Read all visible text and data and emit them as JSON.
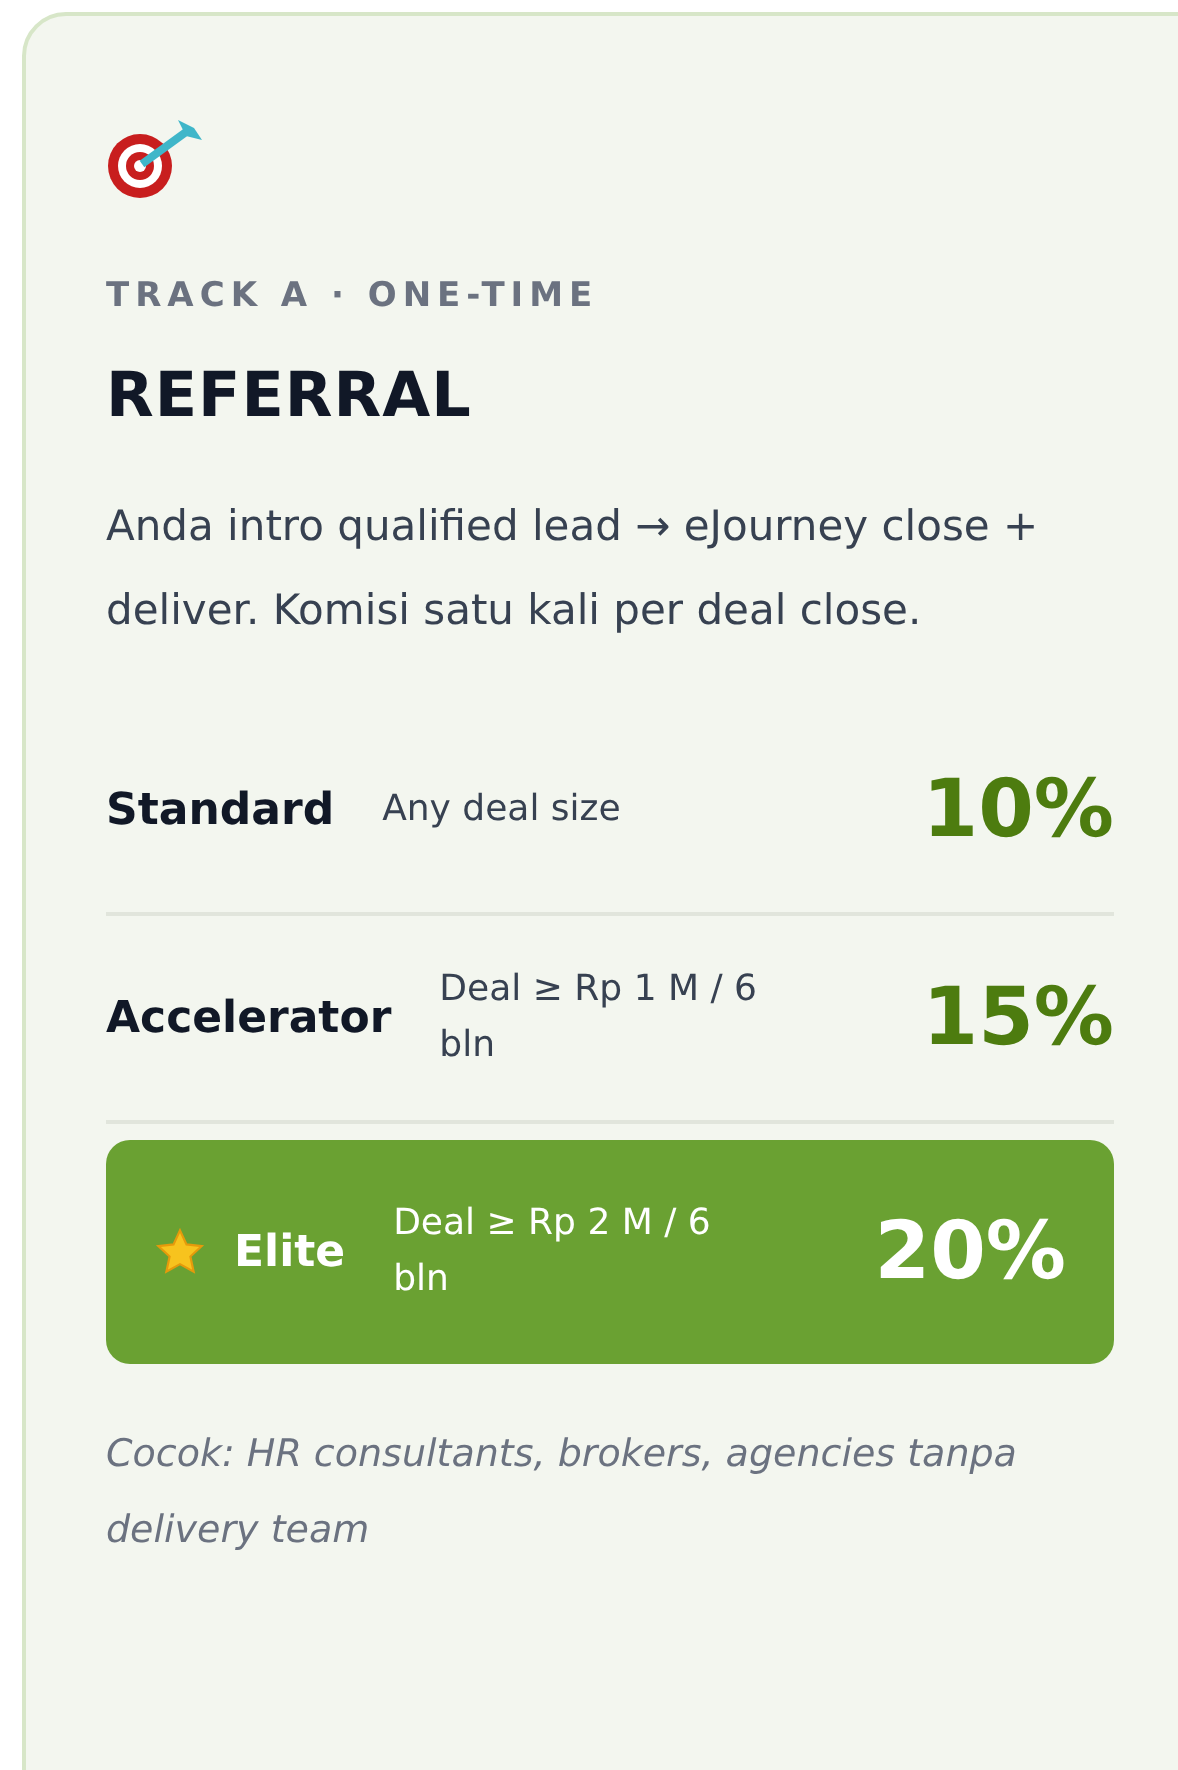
{
  "card": {
    "eyebrow": "TRACK A · ONE-TIME",
    "title": "REFERRAL",
    "description": "Anda intro qualified lead → eJourney close + deliver. Komisi satu kali per deal close.",
    "tiers": [
      {
        "name": "Standard",
        "condition": "Any deal size",
        "rate": "10%",
        "highlighted": false
      },
      {
        "name": "Accelerator",
        "condition": "Deal ≥ Rp 1 M / 6 bln",
        "rate": "15%",
        "highlighted": false
      },
      {
        "name": "Elite",
        "condition": "Deal ≥ Rp 2 M / 6 bln",
        "rate": "20%",
        "highlighted": true
      }
    ],
    "note": "Cocok: HR consultants, brokers, agencies tanpa delivery team"
  }
}
